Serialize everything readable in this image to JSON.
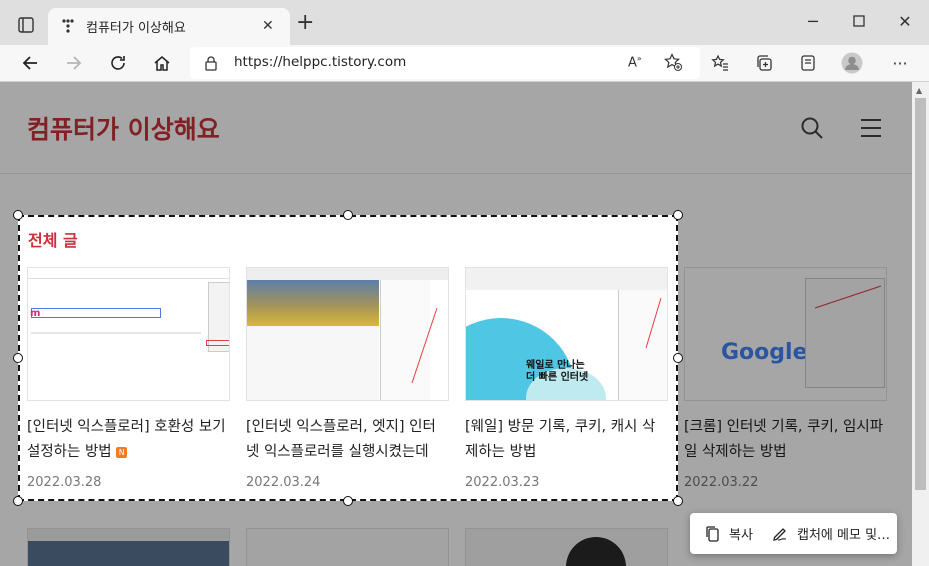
{
  "browser": {
    "tab_title": "컴퓨터가 이상해요",
    "url": "https://helppc.tistory.com"
  },
  "site": {
    "title": "컴퓨터가 이상해요",
    "section_label": "전체 글"
  },
  "posts": [
    {
      "title": "[인터넷 익스플로러] 호환성 보기 설정하는 방법",
      "date": "2022.03.28",
      "badge": "N"
    },
    {
      "title": "[인터넷 익스플로러, 엣지] 인터넷 익스플로러를 실행시켰는데 엣…",
      "date": "2022.03.24"
    },
    {
      "title": "[웨일] 방문 기록, 쿠키, 캐시 삭제하는 방법",
      "date": "2022.03.23",
      "thumb_text": "웨일로 만나는\n더 빠른 인터넷"
    },
    {
      "title": "[크롬] 인터넷 기록, 쿠키, 임시파일 삭제하는 방법",
      "date": "2022.03.22",
      "thumb_text": "Google"
    }
  ],
  "capture_popup": {
    "copy_label": "복사",
    "annotate_label": "캡처에 메모 및…"
  },
  "colors": {
    "accent": "#c8323a",
    "tab_bg": "#dfdfdf"
  }
}
